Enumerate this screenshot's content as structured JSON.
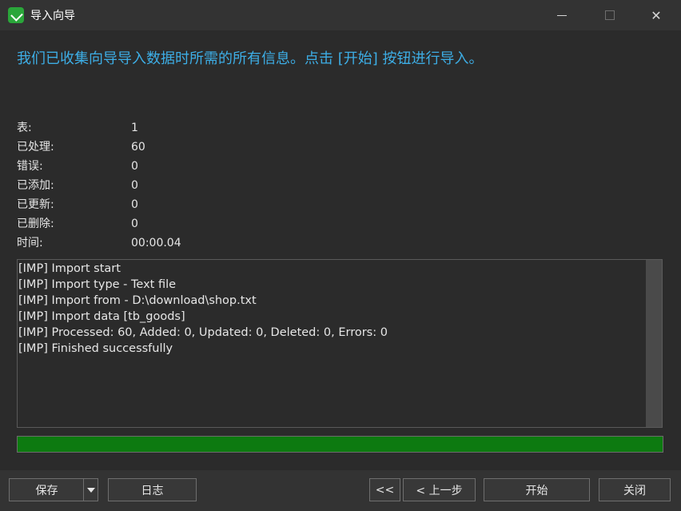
{
  "window": {
    "title": "导入向导",
    "minimize": "",
    "maximize": "",
    "close": "✕"
  },
  "intro": "我们已收集向导导入数据时所需的所有信息。点击 [开始] 按钮进行导入。",
  "stats": [
    {
      "label": "表:",
      "value": "1"
    },
    {
      "label": "已处理:",
      "value": "60"
    },
    {
      "label": "错误:",
      "value": "0"
    },
    {
      "label": "已添加:",
      "value": "0"
    },
    {
      "label": "已更新:",
      "value": "0"
    },
    {
      "label": "已删除:",
      "value": "0"
    },
    {
      "label": "时间:",
      "value": "00:00.04"
    }
  ],
  "log": [
    "[IMP] Import start",
    "[IMP] Import type - Text file",
    "[IMP] Import from - D:\\download\\shop.txt",
    "[IMP] Import data [tb_goods]",
    "[IMP] Processed: 60, Added: 0, Updated: 0, Deleted: 0, Errors: 0",
    "[IMP] Finished successfully"
  ],
  "progress": 1.0,
  "colors": {
    "accent": "#3daee6",
    "progress": "#0d7a10",
    "background": "#2b2b2b"
  },
  "buttons": {
    "save": "保存",
    "log": "日志",
    "first": "<<",
    "prev": "< 上一步",
    "start": "开始",
    "close": "关闭"
  }
}
